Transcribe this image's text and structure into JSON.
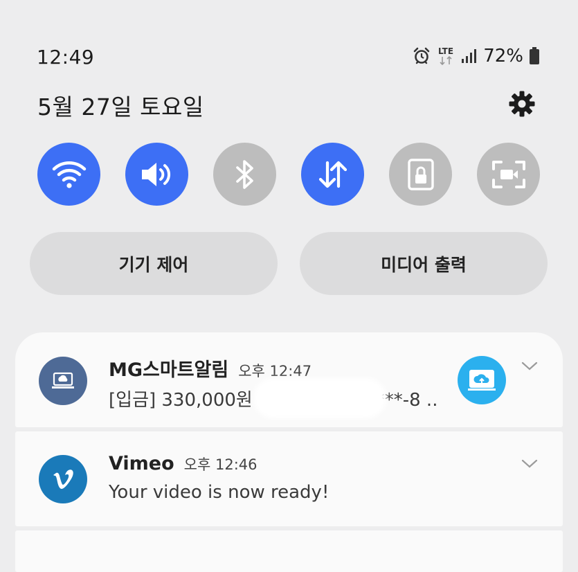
{
  "status_bar": {
    "time": "12:49",
    "network": "LTE",
    "battery": "72%"
  },
  "header": {
    "date": "5월 27일 토요일"
  },
  "quick_toggles": [
    {
      "name": "wifi",
      "icon": "wifi-icon",
      "state": "on"
    },
    {
      "name": "sound",
      "icon": "speaker-icon",
      "state": "on"
    },
    {
      "name": "bluetooth",
      "icon": "bluetooth-icon",
      "state": "off"
    },
    {
      "name": "mobile-data",
      "icon": "data-arrows-icon",
      "state": "on"
    },
    {
      "name": "rotation-lock",
      "icon": "lock-icon",
      "state": "off"
    },
    {
      "name": "screen-recorder",
      "icon": "screen-record-icon",
      "state": "off"
    }
  ],
  "pills": {
    "device_control": "기기 제어",
    "media_output": "미디어 출력"
  },
  "notifications": [
    {
      "app": "MG스마트알림",
      "time": "오후 12:47",
      "text_prefix": "[입금] 330,000원 ",
      "text_visible_partial": "000",
      "text_suffix": "***-8 .."
    },
    {
      "app": "Vimeo",
      "time": "오후 12:46",
      "text": "Your video is now ready!"
    }
  ],
  "colors": {
    "toggle_on": "#3d6ff5",
    "toggle_off": "#bdbdbd",
    "mg_app_icon": "#4e6a96",
    "vimeo_icon": "#1a7ab9",
    "mg_large_icon": "#2bb0ee"
  }
}
